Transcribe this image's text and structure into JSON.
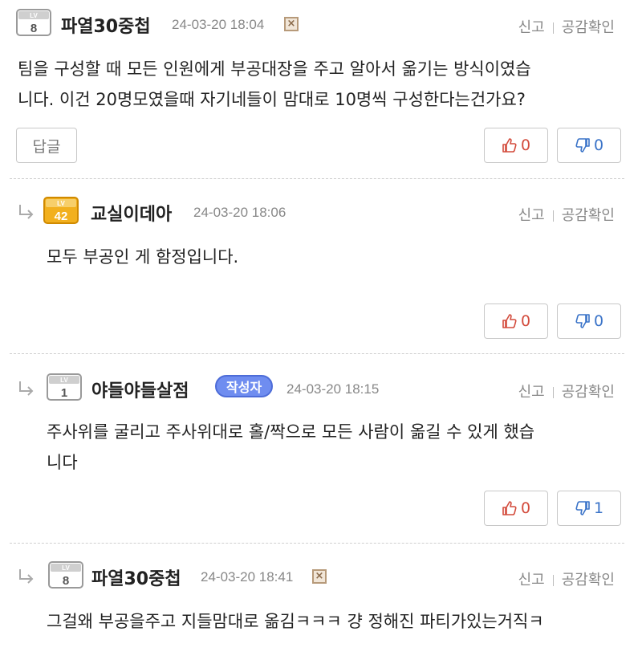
{
  "comments": [
    {
      "level": "8",
      "nickname": "파열30중첩",
      "date": "24-03-20 18:04",
      "report": "신고",
      "empathy_check": "공감확인",
      "text": "팀을 구성할 때 모든 인원에게 부공대장을 주고 알아서 옮기는 방식이였습\n니다.  이건 20명모였을때 자기네들이 맘대로 10명씩 구성한다는건가요?",
      "reply_label": "답글",
      "likes": "0",
      "dislikes": "0"
    },
    {
      "level": "42",
      "nickname": "교실이데아",
      "date": "24-03-20 18:06",
      "report": "신고",
      "empathy_check": "공감확인",
      "text": "모두 부공인 게 함정입니다.",
      "likes": "0",
      "dislikes": "0"
    },
    {
      "level": "1",
      "nickname": "야들야들살점",
      "badge": "작성자",
      "date": "24-03-20 18:15",
      "report": "신고",
      "empathy_check": "공감확인",
      "text": "주사위를 굴리고 주사위대로 홀/짝으로 모든 사람이 옮길 수 있게 했습\n니다",
      "likes": "0",
      "dislikes": "1"
    },
    {
      "level": "8",
      "nickname": "파열30중첩",
      "date": "24-03-20 18:41",
      "report": "신고",
      "empathy_check": "공감확인",
      "text": "그걸왜 부공을주고 지들맘대로 옮김ㅋㅋㅋ 걍 정해진 파티가있는거직ㅋ"
    }
  ],
  "colors": {
    "like": "#d34b3c",
    "dislike": "#3a73c8",
    "author_badge": "#6f8df0",
    "level_gold": "#f2b01e",
    "level_gray": "#9a9a9a"
  }
}
